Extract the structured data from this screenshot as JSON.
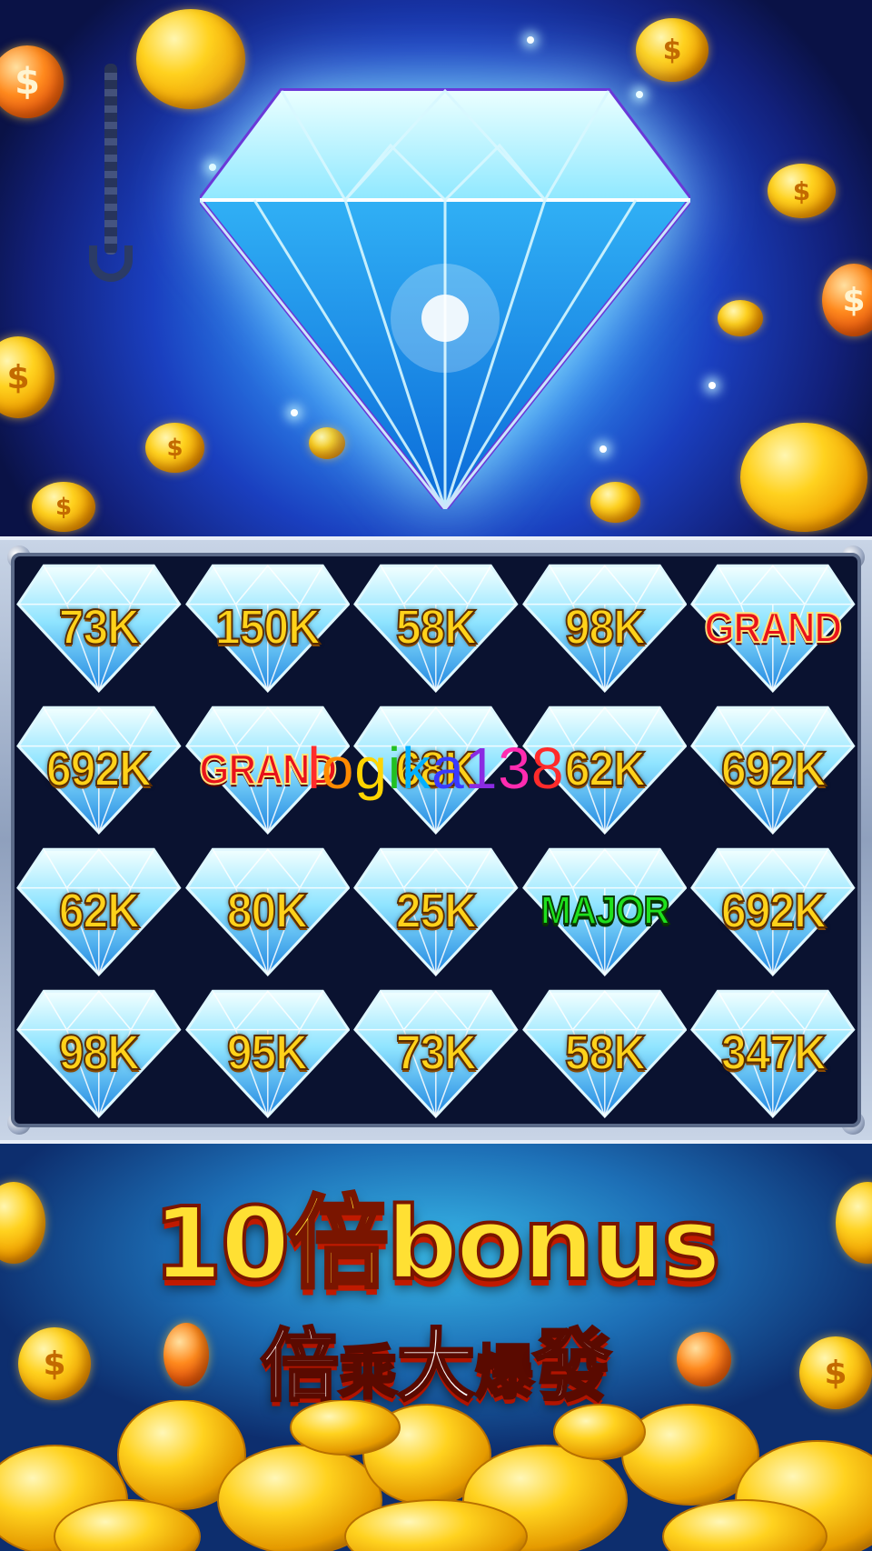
{
  "grid": [
    [
      "73K",
      "150K",
      "58K",
      "98K",
      "GRAND"
    ],
    [
      "692K",
      "GRAND",
      "68K",
      "62K",
      "692K"
    ],
    [
      "62K",
      "80K",
      "25K",
      "MAJOR",
      "692K"
    ],
    [
      "98K",
      "95K",
      "73K",
      "58K",
      "347K"
    ]
  ],
  "watermark": "logika138",
  "promo": {
    "headline": "10倍bonus",
    "sub": [
      "倍",
      "乘",
      "大",
      "爆",
      "發"
    ]
  },
  "coin_symbol": "$",
  "colors": {
    "value_text": "#ffd21a",
    "grand_text": "#e8121a",
    "major_text": "#1ee01e",
    "headline": "#ffe033"
  }
}
